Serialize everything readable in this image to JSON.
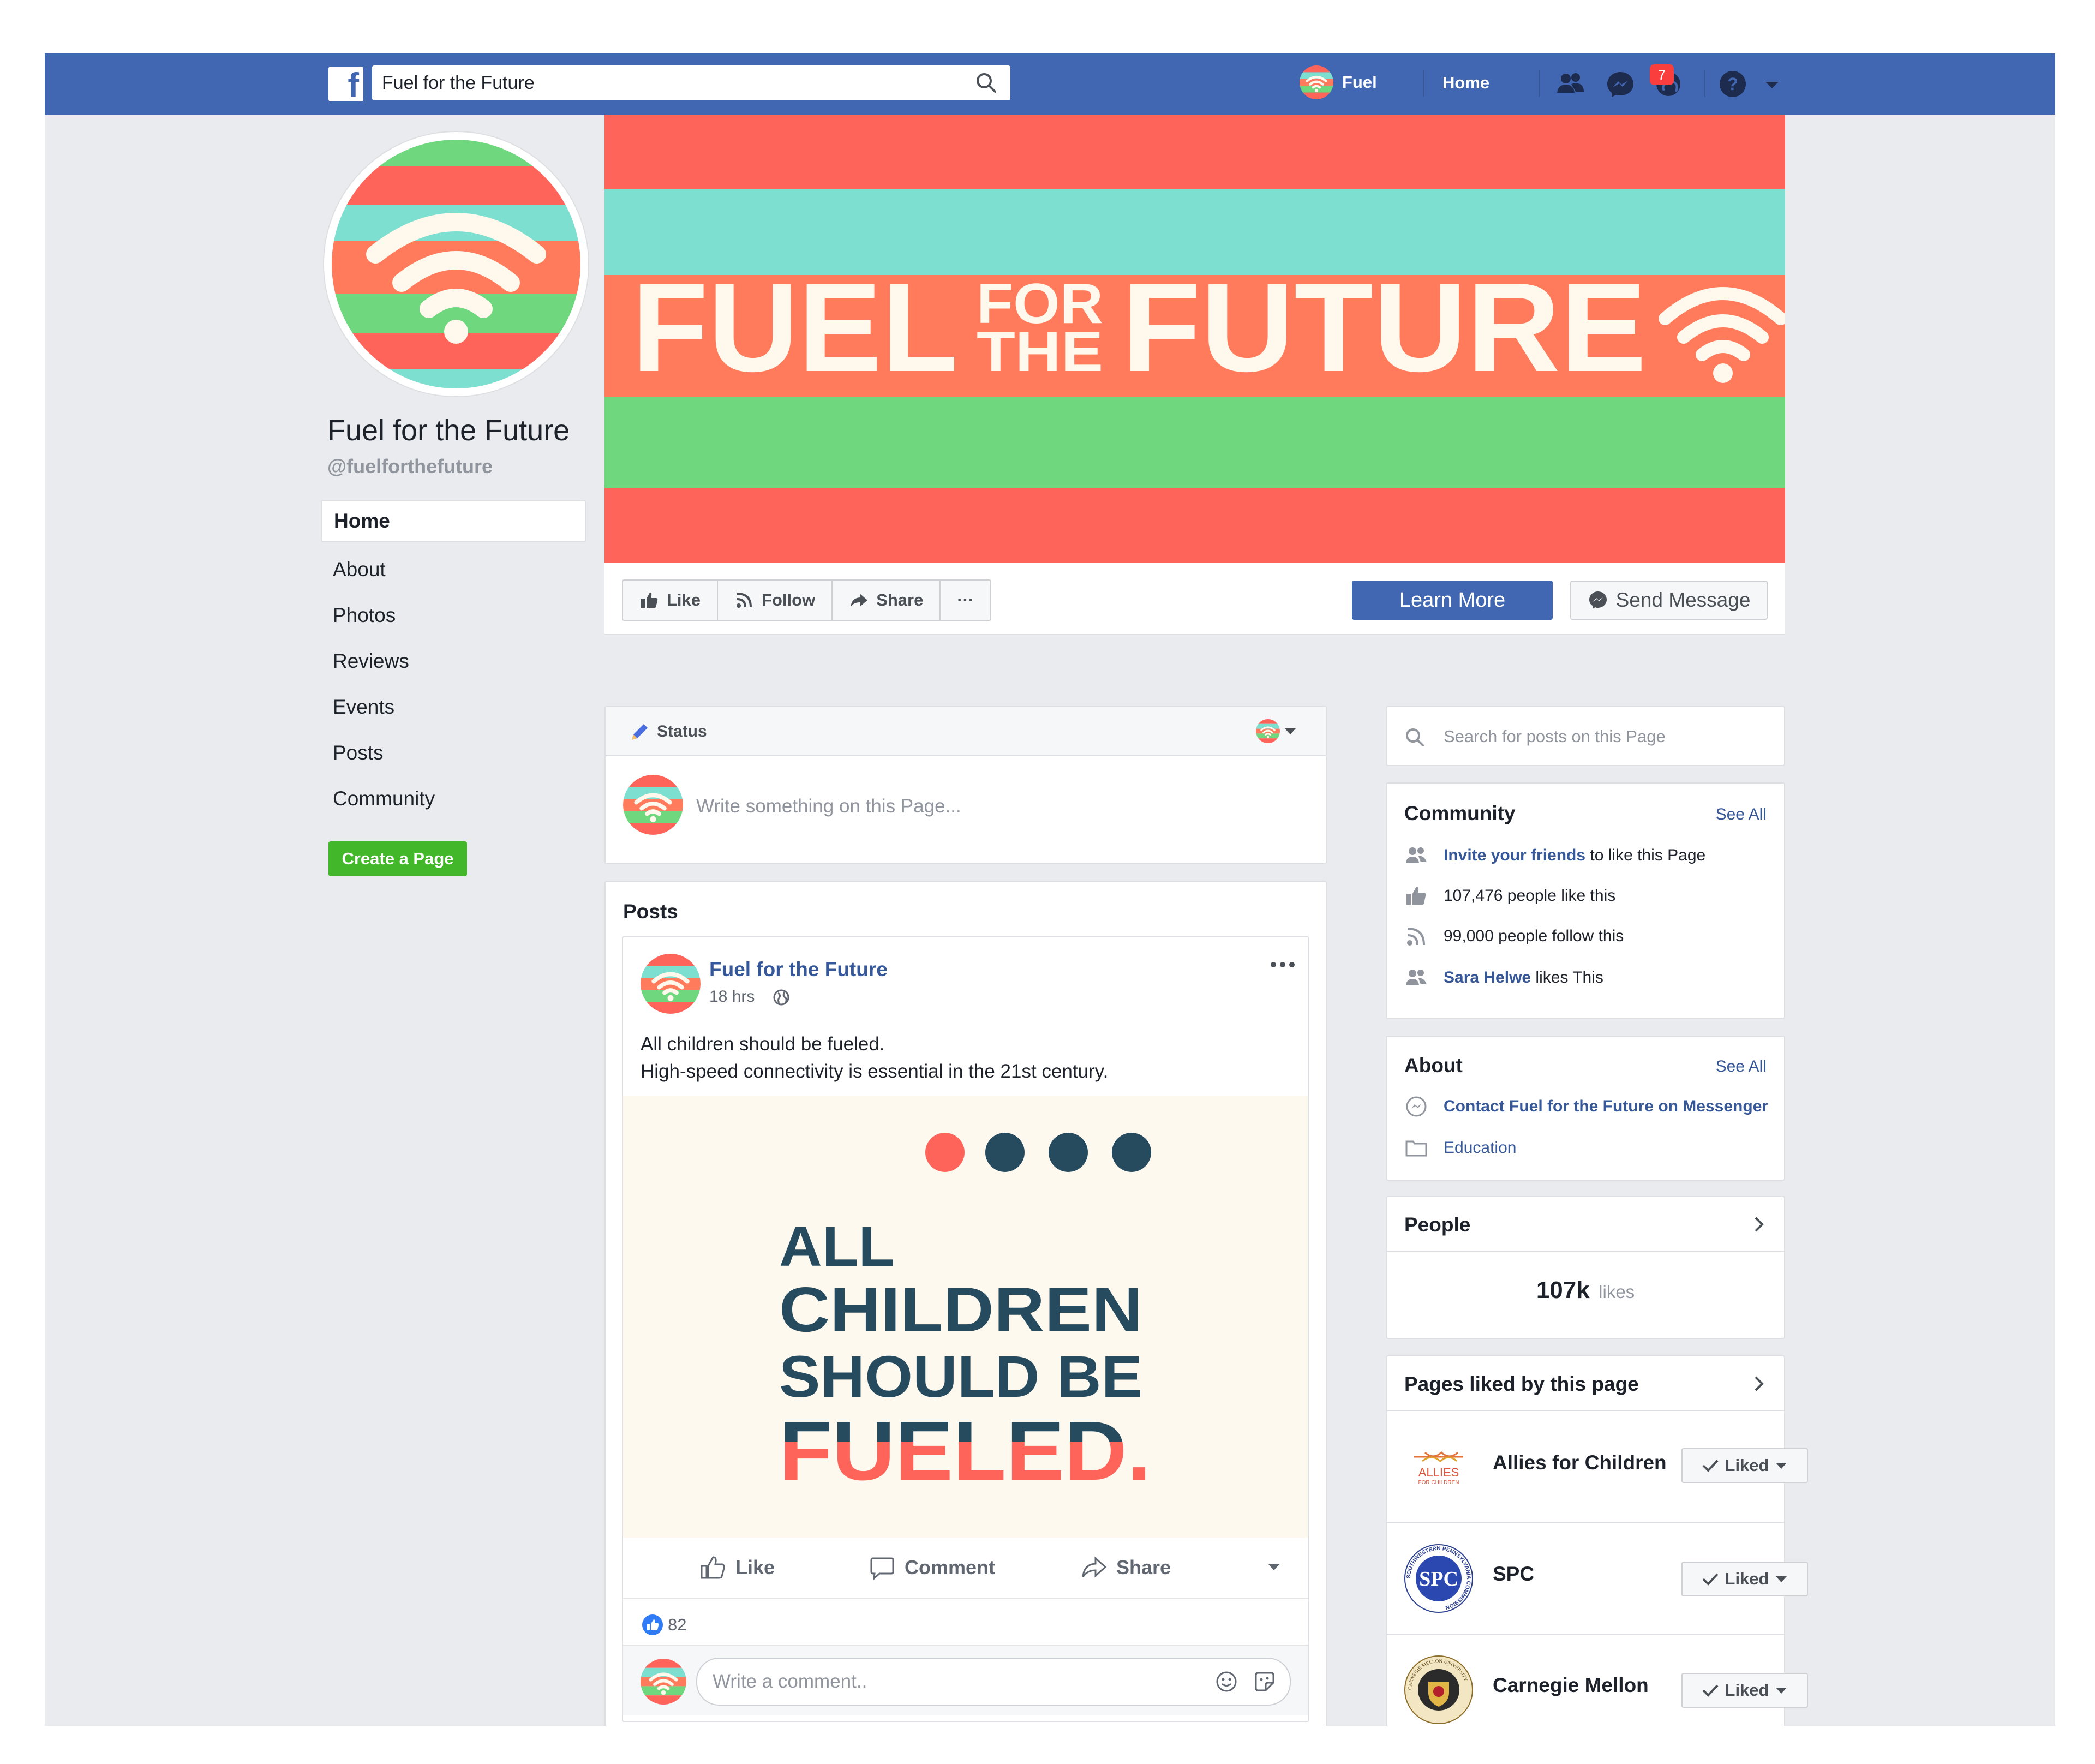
{
  "topbar": {
    "search_value": "Fuel for the Future",
    "profile_name": "Fuel",
    "home_label": "Home",
    "notification_count": "7",
    "brand_color": "#4267b2"
  },
  "page": {
    "name": "Fuel for the Future",
    "handle": "@fuelforthefuture"
  },
  "left_nav": {
    "items": [
      {
        "label": "Home",
        "active": true
      },
      {
        "label": "About"
      },
      {
        "label": "Photos"
      },
      {
        "label": "Reviews"
      },
      {
        "label": "Events"
      },
      {
        "label": "Posts"
      },
      {
        "label": "Community"
      }
    ],
    "create_page": "Create a Page"
  },
  "cover": {
    "word1": "FUEL",
    "word2": "FOR",
    "word3": "THE",
    "word4": "FUTURE",
    "stripe_colors": [
      "#ff645a",
      "#7ddfcf",
      "#ff7b5c",
      "#6fd87f",
      "#ff645a"
    ]
  },
  "actions": {
    "like": "Like",
    "follow": "Follow",
    "share": "Share",
    "more": "···",
    "learn_more": "Learn More",
    "send_message": "Send Message"
  },
  "status": {
    "label": "Status",
    "placeholder": "Write something on this Page..."
  },
  "posts": {
    "title": "Posts",
    "post": {
      "author": "Fuel for the Future",
      "time": "18 hrs",
      "line1": "All children should be fueled.",
      "line2": "High-speed connectivity is essential in the 21st century.",
      "image": {
        "line1": "ALL",
        "line2": "CHILDREN",
        "line3": "SHOULD  BE",
        "line4": "FUELED."
      },
      "like": "Like",
      "comment": "Comment",
      "share": "Share",
      "reactions": "82",
      "comment_placeholder": "Write a comment.."
    }
  },
  "sidebar": {
    "search_placeholder": "Search for posts on this Page",
    "community": {
      "title": "Community",
      "see_all": "See All",
      "invite_link": "Invite your friends",
      "invite_rest": " to like this Page",
      "likes": "107,476 people like this",
      "follows": "99,000 people follow this",
      "friend": "Sara Helwe",
      "friend_rest": " likes This"
    },
    "about": {
      "title": "About",
      "see_all": "See All",
      "contact": "Contact Fuel for the Future on Messenger",
      "category": "Education"
    },
    "people": {
      "title": "People",
      "count": "107k",
      "unit": "likes"
    },
    "pages_liked": {
      "title": "Pages liked by this page",
      "liked_label": "Liked",
      "items": [
        {
          "name": "Allies for Children",
          "logo_text": "ALLIES",
          "logo_sub": "FOR CHILDREN"
        },
        {
          "name": "SPC",
          "logo_text": "SPC",
          "logo_ring": "SOUTHWESTERN PENNSYLVANIA COMMISSION"
        },
        {
          "name": "Carnegie Mellon",
          "logo_ring": "CARNEGIE MELLON UNIVERSITY"
        }
      ]
    }
  }
}
